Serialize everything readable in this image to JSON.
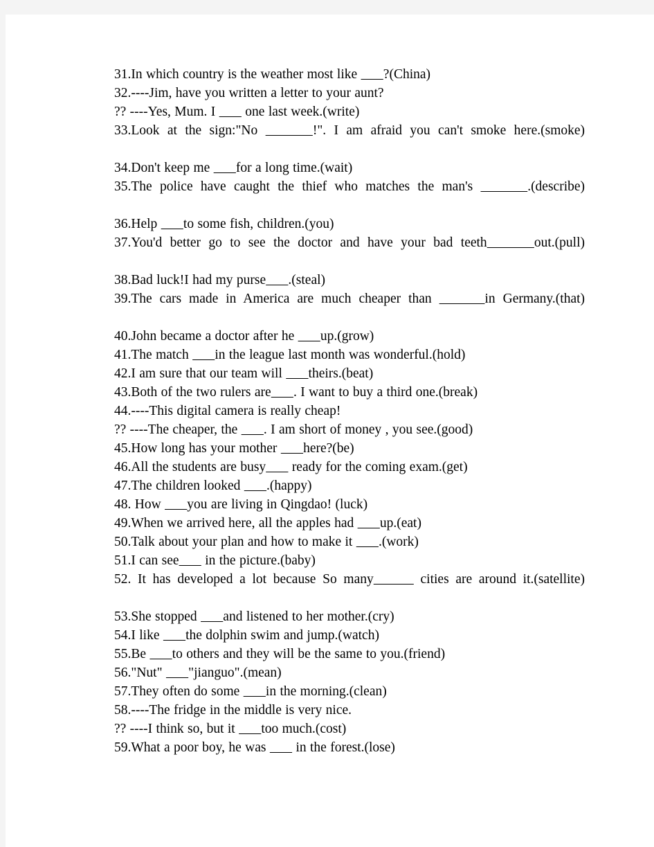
{
  "page": {
    "background_color": "#f4f4f4",
    "paper_color": "#ffffff",
    "text_color": "#000000"
  },
  "document": {
    "type": "worksheet",
    "description": "English grammar fill-in-the-blank exercise, items 31-59, each followed by the root word in parentheses",
    "lines": [
      {
        "id": "q31",
        "text": "31.In which country is the weather most like ______?(China)"
      },
      {
        "id": "q32",
        "text": "32.----Jim, have you written a letter to your aunt?"
      },
      {
        "id": "q32b",
        "text": "?? ----Yes, Mum. I ______ one last week.(write)"
      },
      {
        "id": "q33",
        "text": "33.Look at the sign:\"No ______!\". I am afraid you can't smoke here.(smoke)"
      },
      {
        "id": "q34",
        "text": "34.Don't keep me ______for a long time.(wait)"
      },
      {
        "id": "q35",
        "text": "35.The police have caught the thief who matches the man's ______.(describe)"
      },
      {
        "id": "q36",
        "text": "36.Help ______to some fish, children.(you)"
      },
      {
        "id": "q37",
        "text": "37.You'd better go to see the doctor and have your bad teeth______out.(pull)"
      },
      {
        "id": "q38",
        "text": "38.Bad luck!I had my purse______.(steal)"
      },
      {
        "id": "q39",
        "text": "39.The cars made in America are much cheaper than ______in Germany.(that)"
      },
      {
        "id": "q40",
        "text": "40.John became a doctor after he ______up.(grow)"
      },
      {
        "id": "q41",
        "text": "41.The match ______in the league last month was wonderful.(hold)"
      },
      {
        "id": "q42",
        "text": "42.I am sure that our team will ______theirs.(beat)"
      },
      {
        "id": "q43",
        "text": "43.Both of the two rulers are______. I want to buy a third one.(break)"
      },
      {
        "id": "q44",
        "text": "44.----This digital camera is really cheap!"
      },
      {
        "id": "q44b",
        "text": "?? ----The cheaper, the ______. I am short of money , you see.(good)"
      },
      {
        "id": "q45",
        "text": "45.How long has your mother ______here?(be)"
      },
      {
        "id": "q46",
        "text": "46.All the students are busy______ ready for the coming exam.(get)"
      },
      {
        "id": "q47",
        "text": "47.The children looked ______.(happy)"
      },
      {
        "id": "q48",
        "text": "48. How ______you are living in Qingdao! (luck)"
      },
      {
        "id": "q49",
        "text": "49.When we arrived here, all the apples had ______up.(eat)"
      },
      {
        "id": "q50",
        "text": "50.Talk about your plan and how to make it ______.(work)"
      },
      {
        "id": "q51",
        "text": "51.I can see______ in the picture.(baby)"
      },
      {
        "id": "q52",
        "text": "52. It has developed a lot because So many______ cities are around it.(satellite)"
      },
      {
        "id": "q53",
        "text": "53.She stopped ______and listened to her mother.(cry)"
      },
      {
        "id": "q54",
        "text": "54.I like ______the dolphin swim and jump.(watch)"
      },
      {
        "id": "q55",
        "text": "55.Be ______to others and they will be the same to you.(friend)"
      },
      {
        "id": "q56",
        "text": "56.\"Nut\" ______\"jianguo\".(mean)"
      },
      {
        "id": "q57",
        "text": "57.They often do some ______in the morning.(clean)"
      },
      {
        "id": "q58",
        "text": "58.----The fridge in the middle is very nice."
      },
      {
        "id": "q58b",
        "text": "?? ----I think so, but it ______too much.(cost)"
      },
      {
        "id": "q59",
        "text": "59.What a poor boy, he was ______ in the forest.(lose)"
      }
    ]
  }
}
